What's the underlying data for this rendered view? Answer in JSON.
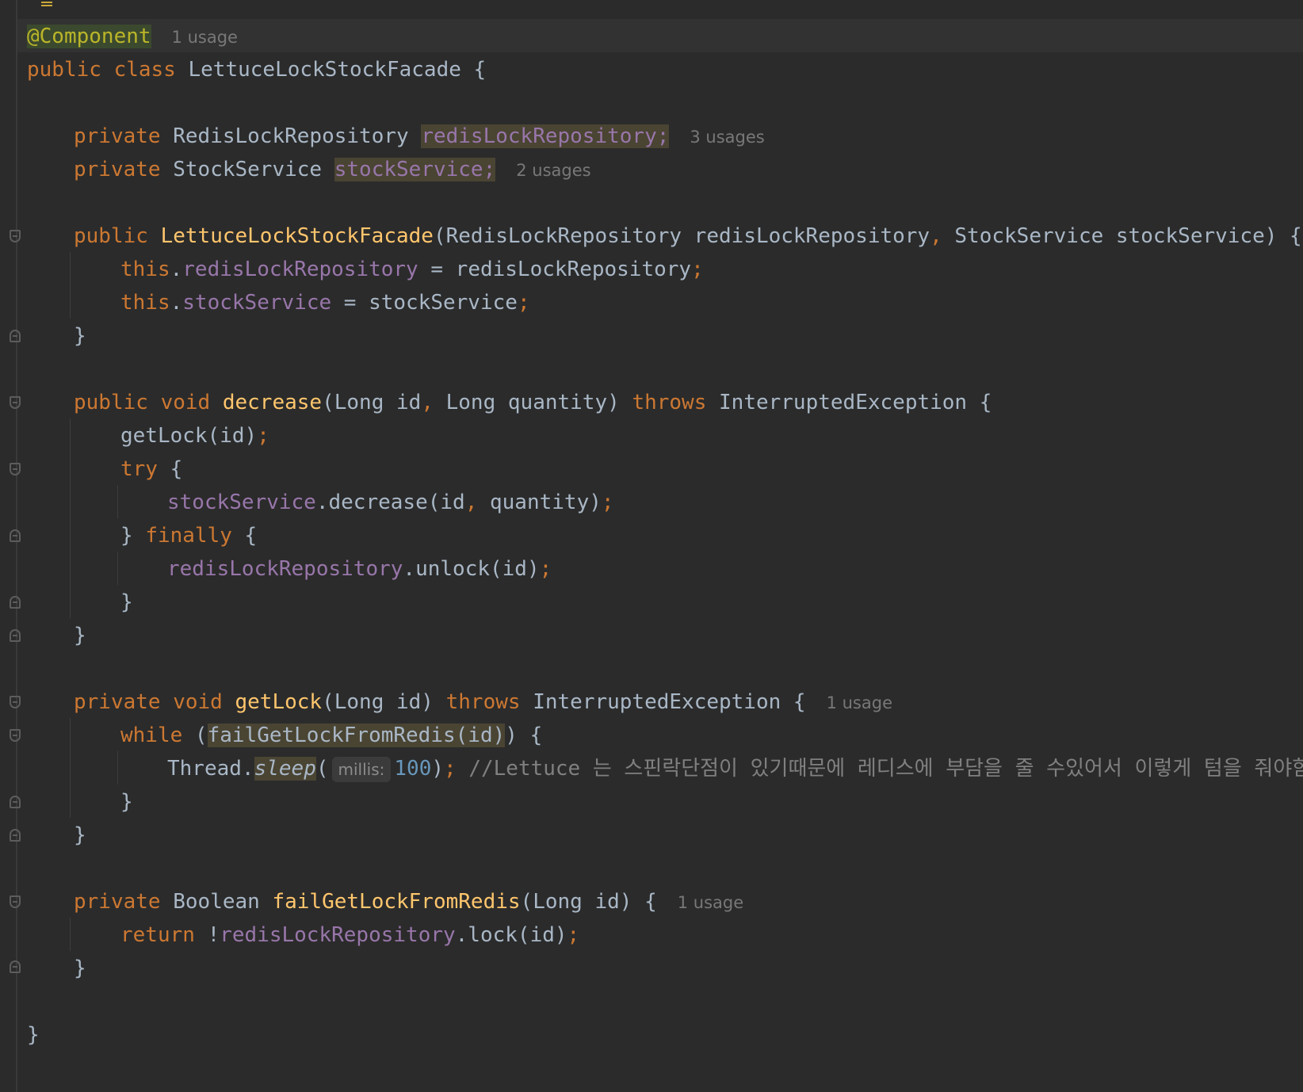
{
  "editor": {
    "language": "java",
    "colors": {
      "background": "#2b2b2b",
      "keyword": "#cc7832",
      "annotation": "#bbb529",
      "method": "#ffc66d",
      "field": "#9876aa",
      "number": "#6897bb",
      "comment": "#808080",
      "text": "#a9b7c6"
    },
    "lines": [
      {
        "indent": 0,
        "tokens": [
          {
            "t": "@Component",
            "c": "ann",
            "h": "hl-ann"
          }
        ],
        "hint": "1 usage"
      },
      {
        "indent": 0,
        "tokens": [
          {
            "t": "public class ",
            "c": "kw"
          },
          {
            "t": "LettuceLockStockFacade {"
          }
        ]
      },
      {
        "indent": 0,
        "tokens": []
      },
      {
        "indent": 1,
        "tokens": [
          {
            "t": "private ",
            "c": "kw"
          },
          {
            "t": "RedisLockRepository "
          },
          {
            "t": "redisLockRepository;",
            "c": "fld",
            "h": "hl"
          }
        ],
        "hint": "3 usages"
      },
      {
        "indent": 1,
        "tokens": [
          {
            "t": "private ",
            "c": "kw"
          },
          {
            "t": "StockService "
          },
          {
            "t": "stockService;",
            "c": "fld",
            "h": "hl"
          }
        ],
        "hint": "2 usages"
      },
      {
        "indent": 0,
        "tokens": []
      },
      {
        "indent": 1,
        "tokens": [
          {
            "t": "public ",
            "c": "kw"
          },
          {
            "t": "LettuceLockStockFacade",
            "c": "fn"
          },
          {
            "t": "(RedisLockRepository redisLockRepository"
          },
          {
            "t": ", ",
            "c": "punc"
          },
          {
            "t": "StockService stockService) {"
          }
        ]
      },
      {
        "indent": 2,
        "tokens": [
          {
            "t": "this",
            "c": "kw"
          },
          {
            "t": "."
          },
          {
            "t": "redisLockRepository",
            "c": "fld"
          },
          {
            "t": " = redisLockRepository"
          },
          {
            "t": ";",
            "c": "punc"
          }
        ]
      },
      {
        "indent": 2,
        "tokens": [
          {
            "t": "this",
            "c": "kw"
          },
          {
            "t": "."
          },
          {
            "t": "stockService",
            "c": "fld"
          },
          {
            "t": " = stockService"
          },
          {
            "t": ";",
            "c": "punc"
          }
        ]
      },
      {
        "indent": 1,
        "tokens": [
          {
            "t": "}"
          }
        ]
      },
      {
        "indent": 0,
        "tokens": []
      },
      {
        "indent": 1,
        "tokens": [
          {
            "t": "public void ",
            "c": "kw"
          },
          {
            "t": "decrease",
            "c": "fn"
          },
          {
            "t": "(Long id"
          },
          {
            "t": ", ",
            "c": "punc"
          },
          {
            "t": "Long quantity) "
          },
          {
            "t": "throws ",
            "c": "kw"
          },
          {
            "t": "InterruptedException {"
          }
        ]
      },
      {
        "indent": 2,
        "tokens": [
          {
            "t": "getLock(id)"
          },
          {
            "t": ";",
            "c": "punc"
          }
        ]
      },
      {
        "indent": 2,
        "tokens": [
          {
            "t": "try ",
            "c": "kw"
          },
          {
            "t": "{"
          }
        ]
      },
      {
        "indent": 3,
        "tokens": [
          {
            "t": "stockService",
            "c": "fld"
          },
          {
            "t": ".decrease(id"
          },
          {
            "t": ", ",
            "c": "punc"
          },
          {
            "t": "quantity)"
          },
          {
            "t": ";",
            "c": "punc"
          }
        ]
      },
      {
        "indent": 2,
        "tokens": [
          {
            "t": "} "
          },
          {
            "t": "finally ",
            "c": "kw"
          },
          {
            "t": "{"
          }
        ]
      },
      {
        "indent": 3,
        "tokens": [
          {
            "t": "redisLockRepository",
            "c": "fld"
          },
          {
            "t": ".unlock(id)"
          },
          {
            "t": ";",
            "c": "punc"
          }
        ]
      },
      {
        "indent": 2,
        "tokens": [
          {
            "t": "}"
          }
        ]
      },
      {
        "indent": 1,
        "tokens": [
          {
            "t": "}"
          }
        ]
      },
      {
        "indent": 0,
        "tokens": []
      },
      {
        "indent": 1,
        "tokens": [
          {
            "t": "private void ",
            "c": "kw"
          },
          {
            "t": "getLock",
            "c": "fn"
          },
          {
            "t": "(Long id) "
          },
          {
            "t": "throws ",
            "c": "kw"
          },
          {
            "t": "InterruptedException {"
          }
        ],
        "hint": "1 usage"
      },
      {
        "indent": 2,
        "tokens": [
          {
            "t": "while ",
            "c": "kw"
          },
          {
            "t": "("
          },
          {
            "t": "failGetLockFromRedis(id)",
            "h": "hl"
          },
          {
            "t": ") {"
          }
        ]
      },
      {
        "indent": 3,
        "tokens": [
          {
            "t": "Thread."
          },
          {
            "t": "sleep",
            "c": "italic",
            "h": "hl"
          },
          {
            "t": "("
          },
          {
            "inlay": "millis:"
          },
          {
            "t": "100",
            "c": "num"
          },
          {
            "t": ")"
          },
          {
            "t": "; ",
            "c": "punc"
          },
          {
            "t": "//Lettuce 는 스핀락단점이 있기때문에 레디스에 부담을 줄 수있어서 이렇게 텀을 줘야함",
            "c": "cm"
          }
        ]
      },
      {
        "indent": 2,
        "tokens": [
          {
            "t": "}"
          }
        ]
      },
      {
        "indent": 1,
        "tokens": [
          {
            "t": "}"
          }
        ]
      },
      {
        "indent": 0,
        "tokens": []
      },
      {
        "indent": 1,
        "tokens": [
          {
            "t": "private ",
            "c": "kw"
          },
          {
            "t": "Boolean "
          },
          {
            "t": "failGetLockFromRedis",
            "c": "fn"
          },
          {
            "t": "(Long id) {"
          }
        ],
        "hint": "1 usage"
      },
      {
        "indent": 2,
        "tokens": [
          {
            "t": "return ",
            "c": "kw"
          },
          {
            "t": "!"
          },
          {
            "t": "redisLockRepository",
            "c": "fld"
          },
          {
            "t": ".lock(id)"
          },
          {
            "t": ";",
            "c": "punc"
          }
        ]
      },
      {
        "indent": 1,
        "tokens": [
          {
            "t": "}"
          }
        ]
      },
      {
        "indent": 0,
        "tokens": []
      },
      {
        "indent": 0,
        "tokens": [
          {
            "t": "}"
          }
        ]
      }
    ]
  }
}
